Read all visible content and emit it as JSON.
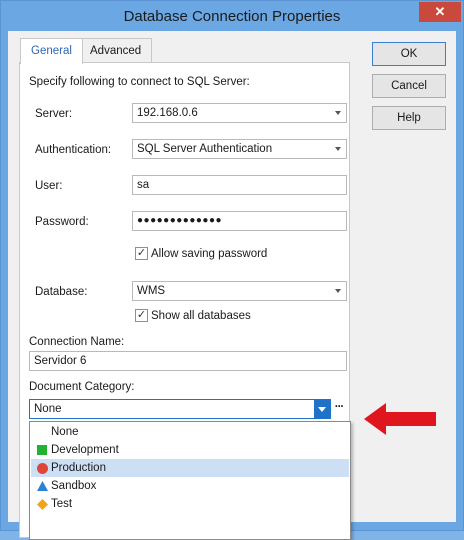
{
  "window": {
    "title": "Database Connection Properties",
    "close_glyph": "✕"
  },
  "tabs": [
    {
      "label": "General"
    },
    {
      "label": "Advanced"
    }
  ],
  "general": {
    "instruction": "Specify following to connect to SQL Server:",
    "server_label": "Server:",
    "server_value": "192.168.0.6",
    "auth_label": "Authentication:",
    "auth_value": "SQL Server Authentication",
    "user_label": "User:",
    "user_value": "sa",
    "password_label": "Password:",
    "password_value": "●●●●●●●●●●●●●",
    "allow_saving_label": "Allow saving password",
    "allow_saving_checked": true,
    "database_label": "Database:",
    "database_value": "WMS",
    "show_all_label": "Show all databases",
    "show_all_checked": true,
    "connection_name_label": "Connection Name:",
    "connection_name_value": "Servidor 6",
    "doc_category_label": "Document Category:",
    "doc_category_value": "None",
    "more_glyph": "···"
  },
  "dropdown": {
    "options": [
      {
        "label": "None",
        "icon": "none",
        "color": ""
      },
      {
        "label": "Development",
        "icon": "green-square-icon",
        "color": "#23b22f"
      },
      {
        "label": "Production",
        "icon": "red-circle-icon",
        "color": "#e0453a"
      },
      {
        "label": "Sandbox",
        "icon": "blue-triangle-icon",
        "color": "#2a82d7"
      },
      {
        "label": "Test",
        "icon": "orange-diamond-icon",
        "color": "#f2a21b"
      }
    ],
    "selected": "Production"
  },
  "buttons": {
    "ok": "OK",
    "cancel": "Cancel",
    "help": "Help"
  },
  "colors": {
    "accent": "#1e72c8",
    "annotation_arrow": "#e0161e"
  }
}
